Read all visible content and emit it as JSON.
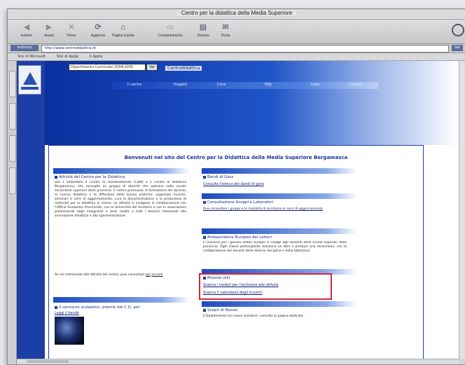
{
  "window": {
    "title": "Centro per la didattica della Media Superiore"
  },
  "toolbar": {
    "buttons": [
      {
        "label": "Indietro",
        "icon": "back-arrow-icon"
      },
      {
        "label": "Avanti",
        "icon": "forward-arrow-icon"
      },
      {
        "label": "Home",
        "icon": "home-icon"
      },
      {
        "label": "Aggiorna",
        "icon": "refresh-icon"
      },
      {
        "label": "Pagina iniziale",
        "icon": "house-icon"
      },
      {
        "label": "Completamento",
        "icon": "autofill-icon"
      },
      {
        "label": "Stampa",
        "icon": "printer-icon"
      },
      {
        "label": "Posta",
        "icon": "mail-icon"
      }
    ]
  },
  "address": {
    "label": "Indirizzo",
    "value": "http://www.centrodidattica.it/",
    "go": "Vai"
  },
  "favorites": [
    "Sito di Microsoft",
    "Sito di Apple",
    "Il Apple"
  ],
  "banner": {
    "select_value": "Dipartimento Curriculari 2004/2005",
    "select_go": "Vai",
    "site_label": "Centrodidattica",
    "nav": [
      "Il centro",
      "Progetti",
      "Corsi",
      "FAQ",
      "Links",
      "Contatti"
    ]
  },
  "main": {
    "welcome": "Benvenuti nel sito del Centro per la Didattica della Media Superiore Bergamasca",
    "left": {
      "box1_title": "Attività del Centro per la Didattica",
      "box1_text": "Dal 1 Settembre il Centro di coordinamento (CDM) e il Centro di Didattica Bergamasca, che raccoglie un gruppo di docenti che operano nelle scuole secondarie superiori della provincia. Il centro promuove la formazione dei docenti, la ricerca didattica e la diffusione delle buone pratiche; organizza incontri, seminari e corsi di aggiornamento, cura la documentazione e la produzione di materiali per la didattica in classe. Le attività si svolgono in collaborazione con l'Ufficio Scolastico Provinciale, con le Università del territorio e con le associazioni professionali degli insegnanti e sono rivolte a tutti i docenti interessati alla innovazione didattica e alla sperimentazione.",
      "box1_more": "Se sei interessato alle attività del centro, puoi consultare",
      "box1_link1": "qui",
      "box1_link2": "Iscriviti",
      "box2_title": "Il concorso scolastico: premio del C.D. per",
      "box2_text": "Leggi il bando"
    },
    "right": {
      "box1_title": "Bandi di Gara",
      "box1_link": "Consulta l'elenco dei bandi di gara",
      "box2_title": "Consultazione Gruppi e Laboratori",
      "box2_text": "Puoi consultare i gruppi e le modalità di iscrizione ai corsi di aggiornamento",
      "box3_title": "Ambasciatore Europeo dei Lettori",
      "box3_text": "Il concorso per i giovani lettori europei si rivolge agli studenti delle scuole superiori della provincia. Ogni classe partecipante seleziona un libro e produce una recensione, con la collaborazione dei docenti delle diverse discipline e della biblioteca.",
      "box4_title": "Risorse utili",
      "box4_link1": "Scarica i moduli per l'iscrizione alle attività",
      "box4_link2": "Scarica il calendario degli incontri",
      "box5_title": "Scopri di Nuovo",
      "box5_text": "Il Dipartimento ha nuove iniziative, consulta la pagina dedicata"
    }
  },
  "colors": {
    "accent": "#1b3fa6",
    "highlight": "#d5263c"
  }
}
